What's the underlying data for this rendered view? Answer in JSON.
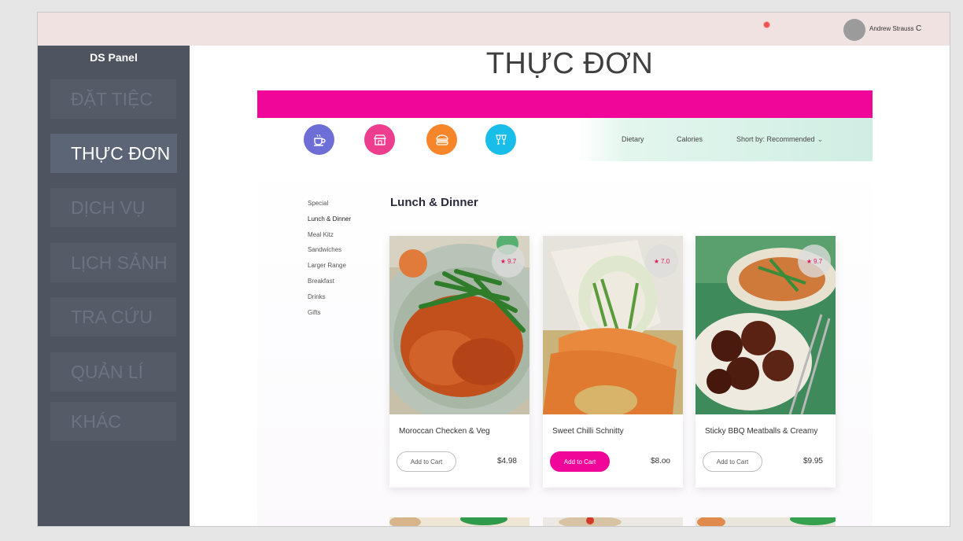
{
  "header": {
    "user_name": "Andrew Strauss",
    "user_menu_caret": "C"
  },
  "sidebar": {
    "title": "DS Panel",
    "items": [
      {
        "label": "ĐẶT TIỆC"
      },
      {
        "label": "THỰC ĐƠN",
        "active": true
      },
      {
        "label": "DỊCH VỤ"
      },
      {
        "label": "LỊCH SẢNH"
      },
      {
        "label": "TRA CỨU"
      },
      {
        "label": "QUẢN LÍ"
      },
      {
        "label": "KHÁC"
      }
    ]
  },
  "main": {
    "title": "THỰC ĐƠN",
    "category_icons": [
      {
        "icon": "coffee-cup-icon",
        "color": "#6e6fd6"
      },
      {
        "icon": "store-icon",
        "color": "#ec3d8f"
      },
      {
        "icon": "burger-icon",
        "color": "#f7862a"
      },
      {
        "icon": "cheers-glasses-icon",
        "color": "#18bde8"
      }
    ],
    "filters": {
      "dietary": "Dietary",
      "calories": "Calories",
      "sort": "Short by: Recommended"
    },
    "categories": [
      "Special",
      "Lunch & Dinner",
      "Meal Kitz",
      "Sandwiches",
      "Larger Range",
      "Breakfast",
      "Drinks",
      "Gifts"
    ],
    "active_category": "Lunch & Dinner",
    "section_title": "Lunch & Dinner",
    "products": [
      {
        "name": "Moroccan Checken & Veg",
        "price": "$4.98",
        "rating": "9.7",
        "cart_label": "Add to Cart",
        "cart_highlight": false
      },
      {
        "name": "Sweet Chilli Schnitty",
        "price": "$8.oo",
        "rating": "7.0",
        "cart_label": "Add to Cart",
        "cart_highlight": true
      },
      {
        "name": "Sticky BBQ Meatballs & Creamy",
        "price": "$9.95",
        "rating": "9.7",
        "cart_label": "Add to Cart",
        "cart_highlight": false
      }
    ]
  },
  "colors": {
    "accent": "#f0079a",
    "sidebar": "#4e5561",
    "topbar": "#efe2e0",
    "notification": "#ef5350"
  }
}
